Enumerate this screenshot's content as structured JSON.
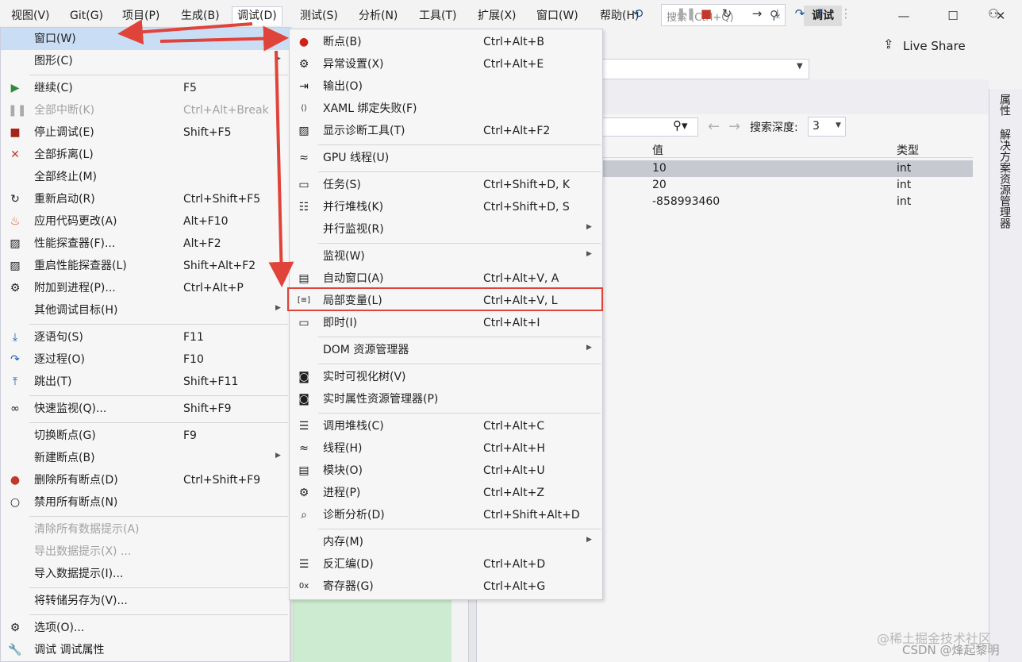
{
  "menubar": {
    "items": [
      "视图(V)",
      "Git(G)",
      "项目(P)",
      "生成(B)",
      "调试(D)",
      "测试(S)",
      "分析(N)",
      "工具(T)",
      "扩展(X)",
      "窗口(W)",
      "帮助(H)"
    ],
    "search_placeholder": "搜索 (Ctrl+Q)",
    "debug_badge": "调试"
  },
  "toolbar": {
    "live_share": "Live Share"
  },
  "locals": {
    "depth_label": "搜索深度:",
    "depth_value": "3",
    "columns": [
      "值",
      "类型"
    ],
    "rows": [
      {
        "value": "10",
        "type": "int"
      },
      {
        "value": "20",
        "type": "int"
      },
      {
        "value": "-858993460",
        "type": "int"
      }
    ]
  },
  "side_tabs": [
    "属性",
    "解决方案资源管理器"
  ],
  "debug_menu": [
    {
      "label": "窗口(W)",
      "shortcut": "",
      "icon": "",
      "submenu": true,
      "highlighted": true
    },
    {
      "label": "图形(C)",
      "shortcut": "",
      "icon": "",
      "submenu": true
    },
    {
      "separator": true
    },
    {
      "label": "继续(C)",
      "shortcut": "F5",
      "icon": "play-icon"
    },
    {
      "label": "全部中断(K)",
      "shortcut": "Ctrl+Alt+Break",
      "icon": "pause-icon",
      "disabled": true
    },
    {
      "label": "停止调试(E)",
      "shortcut": "Shift+F5",
      "icon": "stop-icon"
    },
    {
      "label": "全部拆离(L)",
      "shortcut": "",
      "icon": "x-icon"
    },
    {
      "label": "全部终止(M)",
      "shortcut": "",
      "icon": ""
    },
    {
      "label": "重新启动(R)",
      "shortcut": "Ctrl+Shift+F5",
      "icon": "restart-icon"
    },
    {
      "label": "应用代码更改(A)",
      "shortcut": "Alt+F10",
      "icon": "flame-icon"
    },
    {
      "label": "性能探查器(F)...",
      "shortcut": "Alt+F2",
      "icon": "profiler-icon"
    },
    {
      "label": "重启性能探查器(L)",
      "shortcut": "Shift+Alt+F2",
      "icon": "profiler-icon"
    },
    {
      "label": "附加到进程(P)...",
      "shortcut": "Ctrl+Alt+P",
      "icon": "gears-icon"
    },
    {
      "label": "其他调试目标(H)",
      "shortcut": "",
      "icon": "",
      "submenu": true
    },
    {
      "separator": true
    },
    {
      "label": "逐语句(S)",
      "shortcut": "F11",
      "icon": "step-into-icon"
    },
    {
      "label": "逐过程(O)",
      "shortcut": "F10",
      "icon": "step-over-icon"
    },
    {
      "label": "跳出(T)",
      "shortcut": "Shift+F11",
      "icon": "step-out-icon"
    },
    {
      "separator": true
    },
    {
      "label": "快速监视(Q)...",
      "shortcut": "Shift+F9",
      "icon": "glasses-icon"
    },
    {
      "separator": true
    },
    {
      "label": "切换断点(G)",
      "shortcut": "F9",
      "icon": ""
    },
    {
      "label": "新建断点(B)",
      "shortcut": "",
      "icon": "",
      "submenu": true
    },
    {
      "label": "删除所有断点(D)",
      "shortcut": "Ctrl+Shift+F9",
      "icon": "delete-breakpoints-icon"
    },
    {
      "label": "禁用所有断点(N)",
      "shortcut": "",
      "icon": "disable-breakpoints-icon"
    },
    {
      "separator": true
    },
    {
      "label": "清除所有数据提示(A)",
      "shortcut": "",
      "icon": "",
      "disabled": true
    },
    {
      "label": "导出数据提示(X) ...",
      "shortcut": "",
      "icon": "",
      "disabled": true
    },
    {
      "label": "导入数据提示(I)...",
      "shortcut": "",
      "icon": ""
    },
    {
      "separator": true
    },
    {
      "label": "将转储另存为(V)...",
      "shortcut": "",
      "icon": ""
    },
    {
      "separator": true
    },
    {
      "label": "选项(O)...",
      "shortcut": "",
      "icon": "gear-icon"
    },
    {
      "label": "调试 调试属性",
      "shortcut": "",
      "icon": "wrench-icon"
    }
  ],
  "window_submenu": [
    {
      "label": "断点(B)",
      "shortcut": "Ctrl+Alt+B",
      "icon": "breakpoints-icon"
    },
    {
      "label": "异常设置(X)",
      "shortcut": "Ctrl+Alt+E",
      "icon": "exception-icon"
    },
    {
      "label": "输出(O)",
      "shortcut": "",
      "icon": "output-icon"
    },
    {
      "label": "XAML 绑定失败(F)",
      "shortcut": "",
      "icon": "xaml-icon"
    },
    {
      "label": "显示诊断工具(T)",
      "shortcut": "Ctrl+Alt+F2",
      "icon": "diagnostics-icon"
    },
    {
      "separator": true
    },
    {
      "label": "GPU 线程(U)",
      "shortcut": "",
      "icon": "gpu-threads-icon"
    },
    {
      "separator": true
    },
    {
      "label": "任务(S)",
      "shortcut": "Ctrl+Shift+D, K",
      "icon": "tasks-icon"
    },
    {
      "label": "并行堆栈(K)",
      "shortcut": "Ctrl+Shift+D, S",
      "icon": "parallel-stacks-icon"
    },
    {
      "label": "并行监视(R)",
      "shortcut": "",
      "icon": "",
      "submenu": true
    },
    {
      "separator": true
    },
    {
      "label": "监视(W)",
      "shortcut": "",
      "icon": "",
      "submenu": true
    },
    {
      "label": "自动窗口(A)",
      "shortcut": "Ctrl+Alt+V, A",
      "icon": "autos-icon"
    },
    {
      "label": "局部变量(L)",
      "shortcut": "Ctrl+Alt+V, L",
      "icon": "locals-icon",
      "boxed": true
    },
    {
      "label": "即时(I)",
      "shortcut": "Ctrl+Alt+I",
      "icon": "immediate-icon"
    },
    {
      "separator": true
    },
    {
      "label": "DOM 资源管理器",
      "shortcut": "",
      "icon": "",
      "submenu": true
    },
    {
      "separator": true
    },
    {
      "label": "实时可视化树(V)",
      "shortcut": "",
      "icon": "camera-icon"
    },
    {
      "label": "实时属性资源管理器(P)",
      "shortcut": "",
      "icon": "camera-icon"
    },
    {
      "separator": true
    },
    {
      "label": "调用堆栈(C)",
      "shortcut": "Ctrl+Alt+C",
      "icon": "call-stack-icon"
    },
    {
      "label": "线程(H)",
      "shortcut": "Ctrl+Alt+H",
      "icon": "threads-icon"
    },
    {
      "label": "模块(O)",
      "shortcut": "Ctrl+Alt+U",
      "icon": "modules-icon"
    },
    {
      "label": "进程(P)",
      "shortcut": "Ctrl+Alt+Z",
      "icon": "processes-icon"
    },
    {
      "label": "诊断分析(D)",
      "shortcut": "Ctrl+Shift+Alt+D",
      "icon": "diagnostic-analysis-icon"
    },
    {
      "separator": true
    },
    {
      "label": "内存(M)",
      "shortcut": "",
      "icon": "",
      "submenu": true
    },
    {
      "label": "反汇编(D)",
      "shortcut": "Ctrl+Alt+D",
      "icon": "disassembly-icon"
    },
    {
      "label": "寄存器(G)",
      "shortcut": "Ctrl+Alt+G",
      "icon": "registers-icon"
    }
  ],
  "icon_glyphs": {
    "play-icon": "▶",
    "pause-icon": "❚❚",
    "stop-icon": "■",
    "x-icon": "✕",
    "restart-icon": "↻",
    "flame-icon": "♨",
    "profiler-icon": "▨",
    "gears-icon": "⚙",
    "step-into-icon": "⤓",
    "step-over-icon": "↷",
    "step-out-icon": "⤒",
    "glasses-icon": "∞",
    "delete-breakpoints-icon": "●",
    "disable-breakpoints-icon": "○",
    "gear-icon": "⚙",
    "wrench-icon": "🔧",
    "breakpoints-icon": "●",
    "exception-icon": "⚙",
    "output-icon": "⇥",
    "xaml-icon": "⟨⟩",
    "diagnostics-icon": "▨",
    "gpu-threads-icon": "≈",
    "tasks-icon": "▭",
    "parallel-stacks-icon": "☷",
    "autos-icon": "▤",
    "locals-icon": "[≡]",
    "immediate-icon": "▭",
    "camera-icon": "◙",
    "call-stack-icon": "☰",
    "threads-icon": "≈",
    "modules-icon": "▤",
    "processes-icon": "⚙",
    "diagnostic-analysis-icon": "⌕",
    "disassembly-icon": "☰",
    "registers-icon": "0x"
  },
  "colors": {
    "accent_red": "#e0433a",
    "highlight": "#c9def5",
    "disabled": "#a2a2a2"
  },
  "watermark": {
    "line1": "@稀土掘金技术社区",
    "line2": "CSDN @烽起黎明"
  }
}
